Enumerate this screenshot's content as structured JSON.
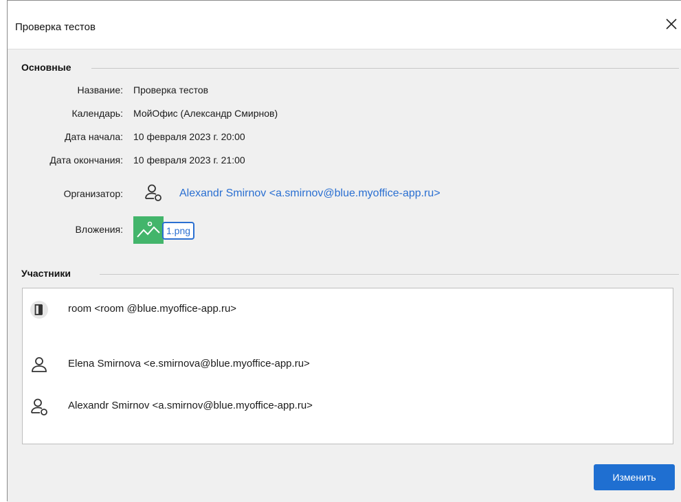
{
  "window": {
    "title": "Проверка тестов"
  },
  "sections": {
    "main": "Основные",
    "participants": "Участники"
  },
  "fields": {
    "name_label": "Название:",
    "name_value": "Проверка тестов",
    "calendar_label": "Календарь:",
    "calendar_value": "МойОфис (Александр Смирнов)",
    "start_label": "Дата начала:",
    "start_value": "10 февраля 2023 г. 20:00",
    "end_label": "Дата окончания:",
    "end_value": "10 февраля 2023 г. 21:00",
    "organizer_label": "Организатор:",
    "organizer_value": "Alexandr Smirnov <a.smirnov@blue.myoffice-app.ru>",
    "attachments_label": "Вложения:",
    "attachment_file": "1.png"
  },
  "participants": [
    {
      "text": "room <room @blue.myoffice-app.ru>",
      "icon": "room-icon"
    },
    {
      "text": "Elena Smirnova <e.smirnova@blue.myoffice-app.ru>",
      "icon": "person-icon"
    },
    {
      "text": "Alexandr Smirnov <a.smirnov@blue.myoffice-app.ru>",
      "icon": "organizer-icon"
    }
  ],
  "buttons": {
    "edit_label": "Изменить"
  },
  "colors": {
    "accent": "#1f6fd1",
    "link": "#2a6fd1",
    "attachment_green": "#43b56b"
  }
}
